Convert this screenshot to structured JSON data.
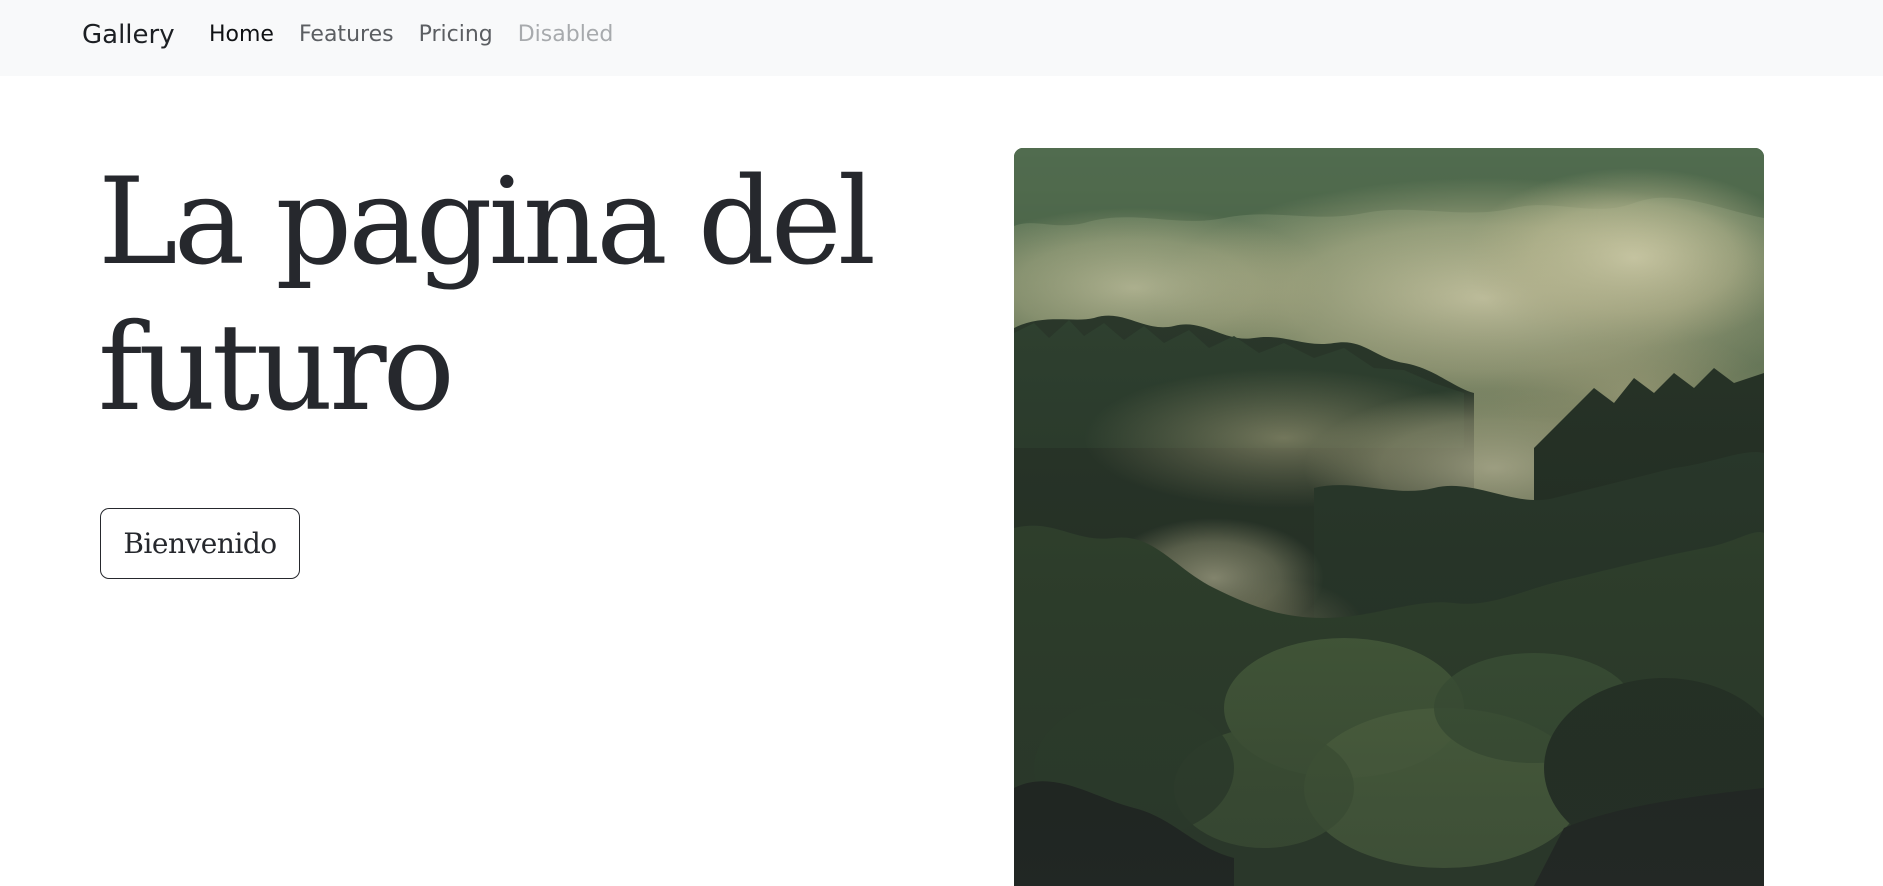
{
  "navbar": {
    "brand": "Gallery",
    "links": [
      {
        "label": "Home",
        "state": "active"
      },
      {
        "label": "Features",
        "state": "default"
      },
      {
        "label": "Pricing",
        "state": "default"
      },
      {
        "label": "Disabled",
        "state": "disabled"
      }
    ]
  },
  "hero": {
    "title": "La pagina del futuro",
    "button_label": "Bienvenido",
    "image": {
      "subject": "misty forest",
      "icon": "forest-photo"
    }
  },
  "colors": {
    "navbar_bg": "#f8f9fa",
    "text_dark": "#26282d",
    "nav_link": "#5b5e62",
    "nav_link_active": "#101214",
    "nav_link_disabled": "#a7aaad",
    "forest_dark": "#2f3b2f",
    "forest_green": "#4d6a45",
    "fog": "#c9c9a6"
  }
}
